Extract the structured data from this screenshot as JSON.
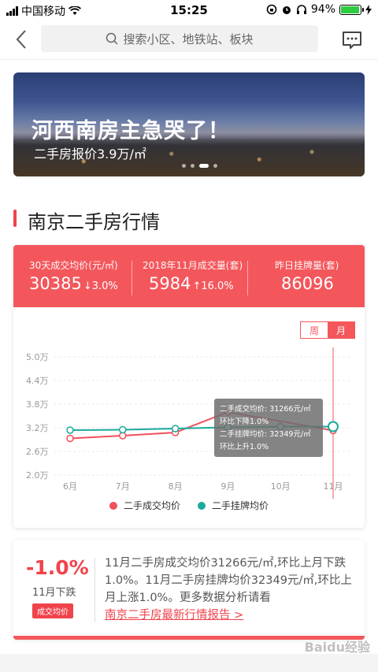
{
  "status_bar": {
    "carrier": "中国移动",
    "time": "15:25",
    "battery": "94%",
    "battery_level": 0.94
  },
  "nav": {
    "search_placeholder": "搜索小区、地铁站、板块"
  },
  "banner": {
    "title": "河西南房主急哭了！",
    "subtitle": "二手房报价3.9万/㎡"
  },
  "section": {
    "title": "南京二手房行情"
  },
  "stats": [
    {
      "label": "30天成交均价(元/㎡)",
      "value": "30385",
      "change": "↓3.0%"
    },
    {
      "label": "2018年11月成交量(套)",
      "value": "5984",
      "change": "↑16.0%"
    },
    {
      "label": "昨日挂牌量(套)",
      "value": "86096",
      "change": ""
    }
  ],
  "toggle": {
    "week": "周",
    "month": "月"
  },
  "chart_data": {
    "type": "line",
    "categories": [
      "6月",
      "7月",
      "8月",
      "9月",
      "10月",
      "11月"
    ],
    "y_ticks": [
      "5.0万",
      "4.4万",
      "3.8万",
      "3.2万",
      "2.6万",
      "2.0万"
    ],
    "ylim": [
      2.0,
      5.0
    ],
    "series": [
      {
        "name": "二手成交均价",
        "color": "#f0505a",
        "values": [
          2.93,
          3.0,
          3.08,
          3.6,
          null,
          3.13
        ]
      },
      {
        "name": "二手挂牌均价",
        "color": "#1aaa9d",
        "values": [
          3.14,
          3.15,
          3.18,
          3.21,
          3.23,
          3.23
        ]
      }
    ],
    "tooltip": [
      "二手成交均价: 31266元/㎡",
      "环比下降1.0%",
      "二手挂牌均价: 32349元/㎡",
      "环比上升1.0%"
    ]
  },
  "summary": {
    "pct": "-1.0%",
    "pct_label": "11月下跌",
    "badge": "成交均价",
    "text": "11月二手房成交均价31266元/㎡,环比上月下跌1.0%。11月二手房挂牌均价32349元/㎡,环比上月上涨1.0%。更多数据分析请看",
    "link": "南京二手房最新行情报告 >"
  },
  "watermark": "Baidu经验"
}
